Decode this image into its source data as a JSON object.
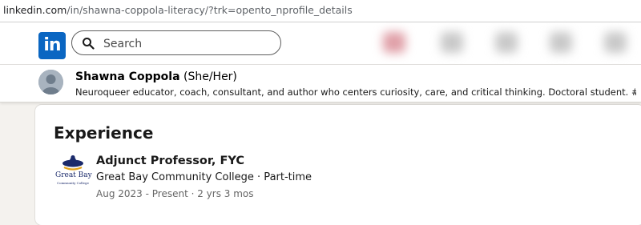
{
  "browser": {
    "url_host": "linkedin.com",
    "url_path": "/in/shawna-coppola-literacy/?trk=opento_nprofile_details"
  },
  "header": {
    "logo_text": "in",
    "search_placeholder": "Search",
    "brand_color": "#0a66c2"
  },
  "profile": {
    "name": "Shawna Coppola",
    "pronouns": "(She/Her)",
    "headline": "Neuroqueer educator, coach, consultant, and author who centers curiosity, care, and critical thinking. Doctoral student. #AuDHD #Actually..."
  },
  "experience": {
    "title": "Experience",
    "items": [
      {
        "role": "Adjunct Professor, FYC",
        "company_line": "Great Bay Community College · Part-time",
        "dates": "Aug 2023 - Present · 2 yrs 3 mos",
        "logo_text": "Great Bay",
        "logo_subtext": "Community College"
      }
    ]
  }
}
